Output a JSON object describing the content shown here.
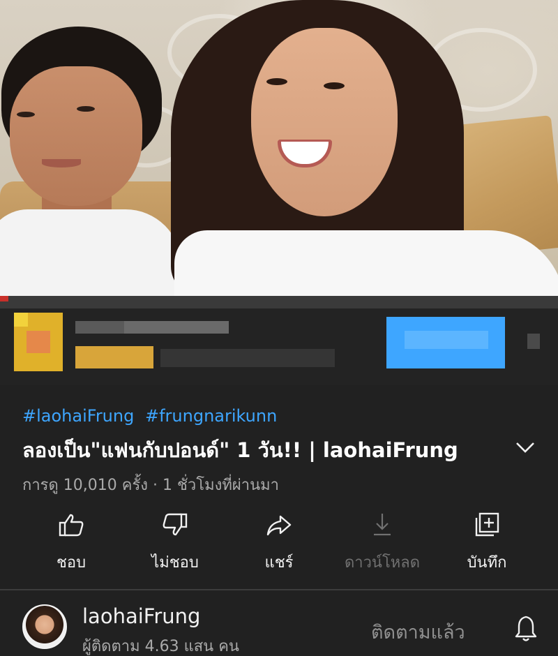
{
  "hashtags": [
    "#laohaiFrung",
    "#frungnarikunn"
  ],
  "video": {
    "title": "ลองเป็น\"แฟนกับปอนด์\" 1 วัน!! | laohaiFrung",
    "views_line": "การดู 10,010 ครั้ง · 1 ชั่วโมงที่ผ่านมา"
  },
  "actions": {
    "like": "ชอบ",
    "dislike": "ไม่ชอบ",
    "share": "แชร์",
    "download": "ดาวน์โหลด",
    "save": "บันทึก"
  },
  "channel": {
    "name": "laohaiFrung",
    "subscribers": "ผู้ติดตาม 4.63 แสน คน",
    "subscribe_state": "ติดตามแล้ว"
  },
  "colors": {
    "background": "#212121",
    "hashtag": "#3ea6ff",
    "text_primary": "#f1f1f1",
    "text_secondary": "#aaaaaa",
    "disabled": "#717171"
  },
  "icons": [
    "chevron-down-icon",
    "thumbs-up-icon",
    "thumbs-down-icon",
    "share-icon",
    "download-icon",
    "save-to-playlist-icon",
    "bell-icon"
  ]
}
